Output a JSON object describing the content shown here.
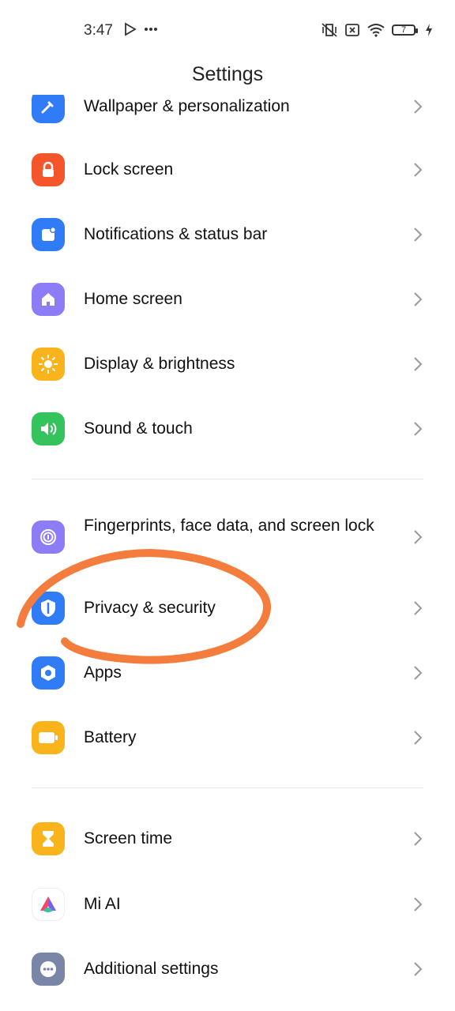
{
  "status_bar": {
    "time": "3:47",
    "left_icons": [
      "play-store-notification-icon",
      "more-dots-icon"
    ],
    "right_icons": [
      "vibrate-off-icon",
      "sim-off-icon",
      "wifi-icon",
      "battery-icon",
      "charging-bolt-icon"
    ],
    "battery_level": "7"
  },
  "header": {
    "title": "Settings"
  },
  "settings": {
    "items": [
      {
        "label": "Wallpaper & personalization",
        "icon": "wallpaper-icon",
        "color": "#2f7cf6"
      },
      {
        "label": "Lock screen",
        "icon": "lock-icon",
        "color": "#f4552b"
      },
      {
        "label": "Notifications & status bar",
        "icon": "notification-icon",
        "color": "#2f7cf6"
      },
      {
        "label": "Home screen",
        "icon": "home-icon",
        "color": "#8c7cf6"
      },
      {
        "label": "Display & brightness",
        "icon": "sun-icon",
        "color": "#f9b41c"
      },
      {
        "label": "Sound & touch",
        "icon": "speaker-icon",
        "color": "#35c35d"
      },
      {
        "label": "Fingerprints, face data, and screen lock",
        "icon": "fingerprint-icon",
        "color": "#8c7cf6"
      },
      {
        "label": "Privacy & security",
        "icon": "shield-icon",
        "color": "#2f7cf6"
      },
      {
        "label": "Apps",
        "icon": "apps-icon",
        "color": "#2f7cf6"
      },
      {
        "label": "Battery",
        "icon": "battery-icon",
        "color": "#f9b41c"
      },
      {
        "label": "Screen time",
        "icon": "hourglass-icon",
        "color": "#f9b41c"
      },
      {
        "label": "Mi AI",
        "icon": "mi-ai-icon",
        "color": "#ffffff"
      },
      {
        "label": "Additional settings",
        "icon": "more-icon",
        "color": "#7a86a8"
      }
    ]
  },
  "annotation": {
    "color": "#f47c3c",
    "target": "Privacy & security"
  }
}
